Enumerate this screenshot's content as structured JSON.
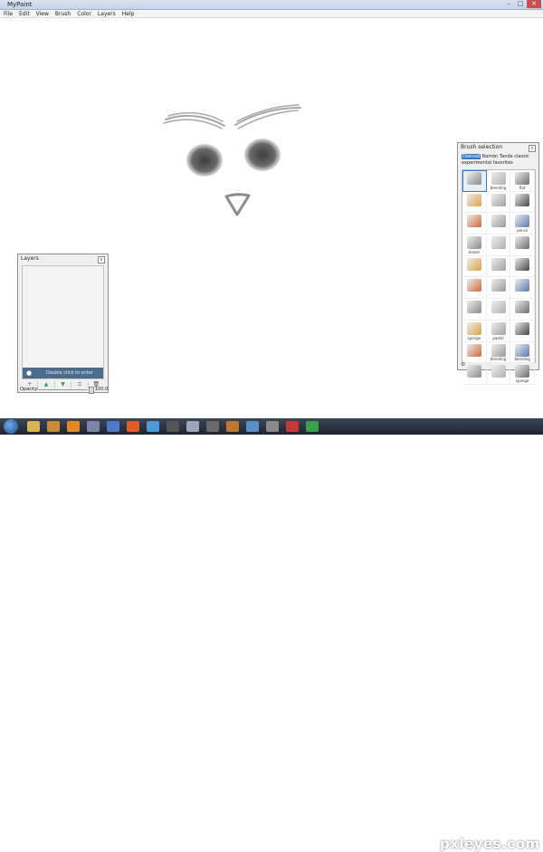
{
  "window": {
    "title": "MyPaint",
    "min": "–",
    "max": "□",
    "close": "✕"
  },
  "menu": [
    "File",
    "Edit",
    "View",
    "Brush",
    "Color",
    "Layers",
    "Help"
  ],
  "layers_panel": {
    "title": "Layers",
    "close": "x",
    "layer_name": "Double click to enter name",
    "buttons": [
      "+",
      "▲",
      "▼",
      "⧉",
      "🗑"
    ],
    "opacity_label": "Opacity:",
    "opacity_value": "100.0"
  },
  "brush_panel": {
    "title": "Brush selection",
    "close": "x",
    "tabs": [
      "Deevad",
      "Ramón",
      "Tanda",
      "classic",
      "experimental",
      "favorites"
    ],
    "selected_tab": "Deevad",
    "brushes": [
      "",
      "blending",
      "flat",
      "",
      "",
      "",
      "",
      "",
      "pencil",
      "eraser",
      "",
      "",
      "",
      "",
      "",
      "",
      "",
      "",
      "",
      "",
      "",
      "sponge",
      "pastel",
      "",
      "",
      "blending",
      "blending",
      "",
      "",
      "sponge"
    ]
  },
  "colors": {
    "taskbar": "#1d2330",
    "selected": "#3a78c9",
    "layer_row": "#4a6c8d"
  },
  "watermark": "pxleyes.com"
}
